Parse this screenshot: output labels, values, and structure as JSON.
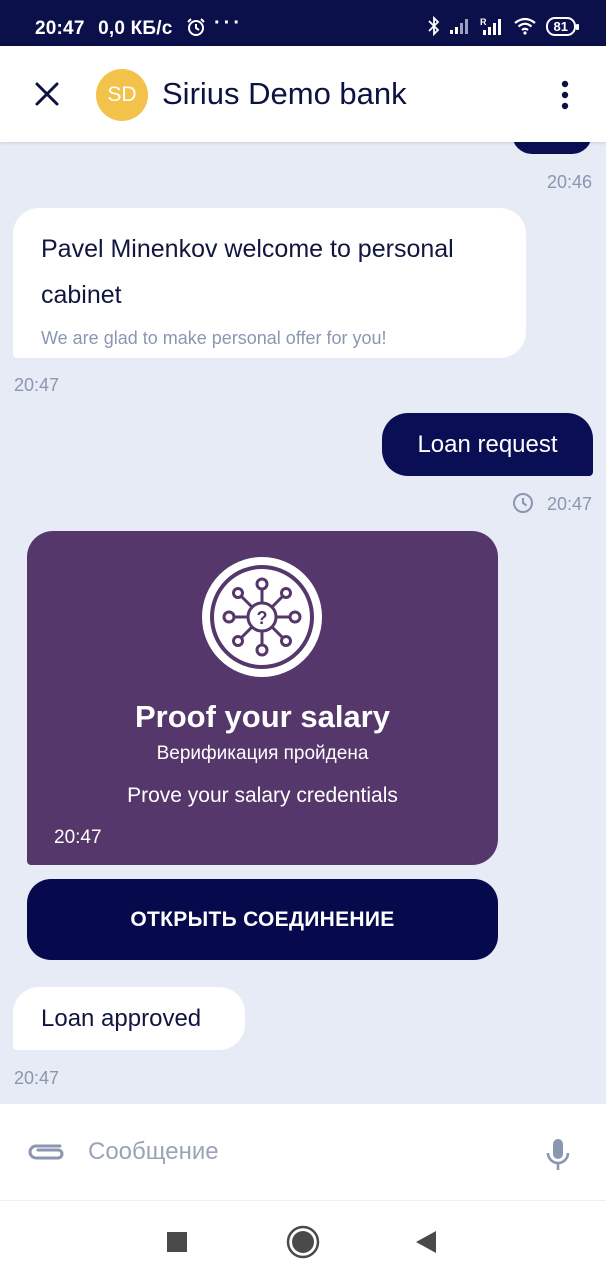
{
  "status_bar": {
    "time": "20:47",
    "network_speed": "0,0 КБ/с",
    "more": "···",
    "battery": "81"
  },
  "header": {
    "avatar_initials": "SD",
    "title": "Sirius Demo bank",
    "avatar_color": "#f2c24a"
  },
  "messages": {
    "prev_time": "20:46",
    "welcome": {
      "text": "Pavel Minenkov welcome to personal cabinet",
      "subtext": "We are glad to make personal offer for you!",
      "time": "20:47"
    },
    "loan_request": {
      "text": "Loan request",
      "time": "20:47"
    },
    "card": {
      "title": "Proof your salary",
      "subtitle": "Верификация пройдена",
      "description": "Prove your salary credentials",
      "time": "20:47",
      "color": "#55376c",
      "button_label": "ОТКРЫТЬ СОЕДИНЕНИЕ"
    },
    "loan_approved": {
      "text": "Loan approved",
      "time": "20:47"
    }
  },
  "composer": {
    "placeholder": "Сообщение",
    "value": ""
  },
  "colors": {
    "primary": "#0a0f55",
    "background": "#e6ebf5"
  }
}
